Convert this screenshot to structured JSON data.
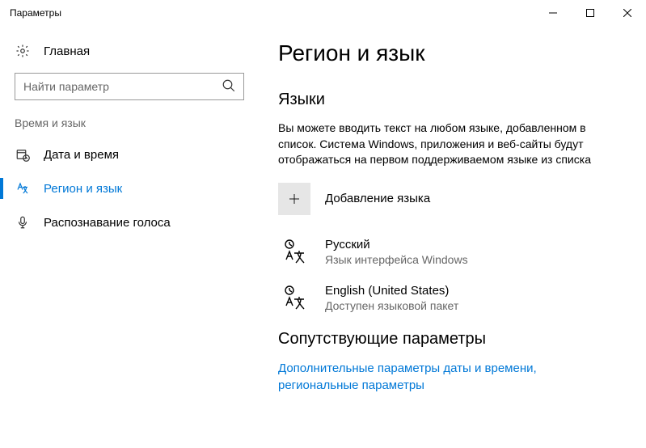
{
  "window": {
    "title": "Параметры"
  },
  "sidebar": {
    "home": "Главная",
    "search_placeholder": "Найти параметр",
    "group": "Время и язык",
    "items": [
      {
        "label": "Дата и время"
      },
      {
        "label": "Регион и язык"
      },
      {
        "label": "Распознавание голоса"
      }
    ]
  },
  "main": {
    "heading": "Регион и язык",
    "languages_heading": "Языки",
    "languages_desc": "Вы можете вводить текст на любом языке, добавленном в список. Система Windows, приложения и веб-сайты будут отображаться на первом поддерживаемом языке из списка",
    "add_language": "Добавление языка",
    "langs": [
      {
        "name": "Русский",
        "status": "Язык интерфейса Windows"
      },
      {
        "name": "English (United States)",
        "status": "Доступен языковой пакет"
      }
    ],
    "related_heading": "Сопутствующие параметры",
    "related_link": "Дополнительные параметры даты и времени, региональные параметры"
  }
}
